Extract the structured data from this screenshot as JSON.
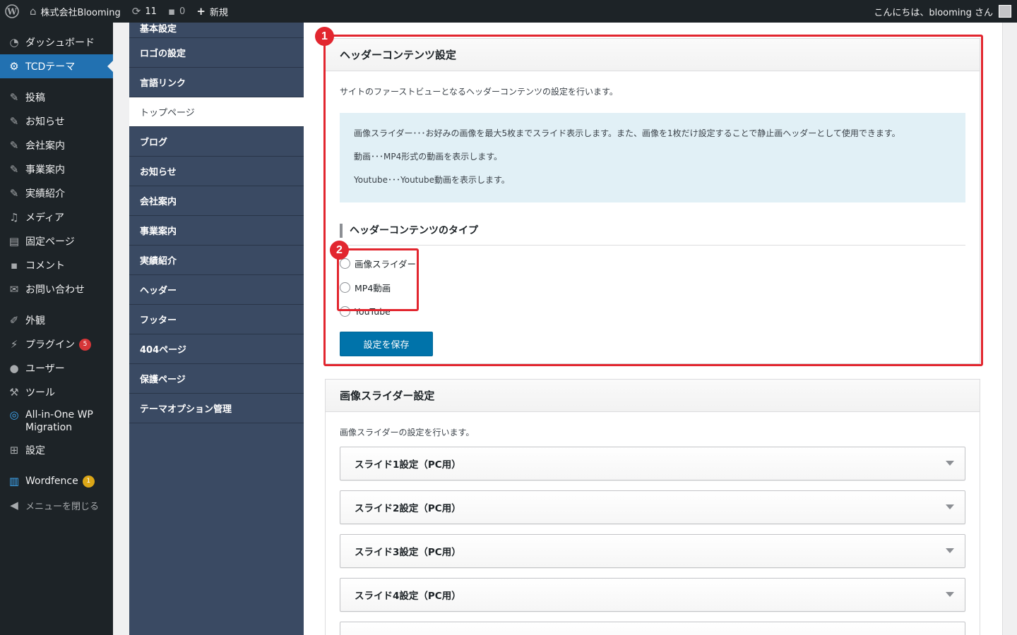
{
  "adminbar": {
    "site_name": "株式会社Blooming",
    "updates_count": "11",
    "comments_count": "0",
    "new_label": "新規",
    "greeting": "こんにちは、blooming さん"
  },
  "admin_menu": {
    "dashboard": "ダッシュボード",
    "tcd_theme": "TCDテーマ",
    "posts": "投稿",
    "news": "お知らせ",
    "company": "会社案内",
    "business": "事業案内",
    "works": "実績紹介",
    "media": "メディア",
    "pages": "固定ページ",
    "comments": "コメント",
    "contact": "お問い合わせ",
    "appearance": "外観",
    "plugins": "プラグイン",
    "plugins_badge": "5",
    "users": "ユーザー",
    "tools": "ツール",
    "aiowpm": "All-in-One WP Migration",
    "settings": "設定",
    "wordfence": "Wordfence",
    "wordfence_badge": "1",
    "collapse": "メニューを閉じる"
  },
  "theme_nav": {
    "items": [
      "基本設定",
      "ロゴの設定",
      "言語リンク",
      "トップページ",
      "ブログ",
      "お知らせ",
      "会社案内",
      "事業案内",
      "実績紹介",
      "ヘッダー",
      "フッター",
      "404ページ",
      "保護ページ",
      "テーマオプション管理"
    ],
    "active_item": "トップページ"
  },
  "header_content": {
    "title": "ヘッダーコンテンツ設定",
    "description": "サイトのファーストビューとなるヘッダーコンテンツの設定を行います。",
    "info_lines": [
      "画像スライダー･･･お好みの画像を最大5枚までスライド表示します。また、画像を1枚だけ設定することで静止画ヘッダーとして使用できます。",
      "動画･･･MP4形式の動画を表示します。",
      "Youtube･･･Youtube動画を表示します。"
    ],
    "type_heading": "ヘッダーコンテンツのタイプ",
    "radio_options": [
      "画像スライダー",
      "MP4動画",
      "YouTube"
    ],
    "save_button": "設定を保存"
  },
  "slider_settings": {
    "title": "画像スライダー設定",
    "description": "画像スライダーの設定を行います。",
    "slides": [
      "スライド1設定（PC用）",
      "スライド2設定（PC用）",
      "スライド3設定（PC用）",
      "スライド4設定（PC用）"
    ]
  },
  "annotations": [
    "1",
    "2"
  ],
  "colors": {
    "admin_bg": "#1d2327",
    "accent": "#2271b1",
    "theme_nav_bg": "#3a4a63",
    "annotation_red": "#e2262f",
    "info_bg": "#e1f0f6"
  }
}
